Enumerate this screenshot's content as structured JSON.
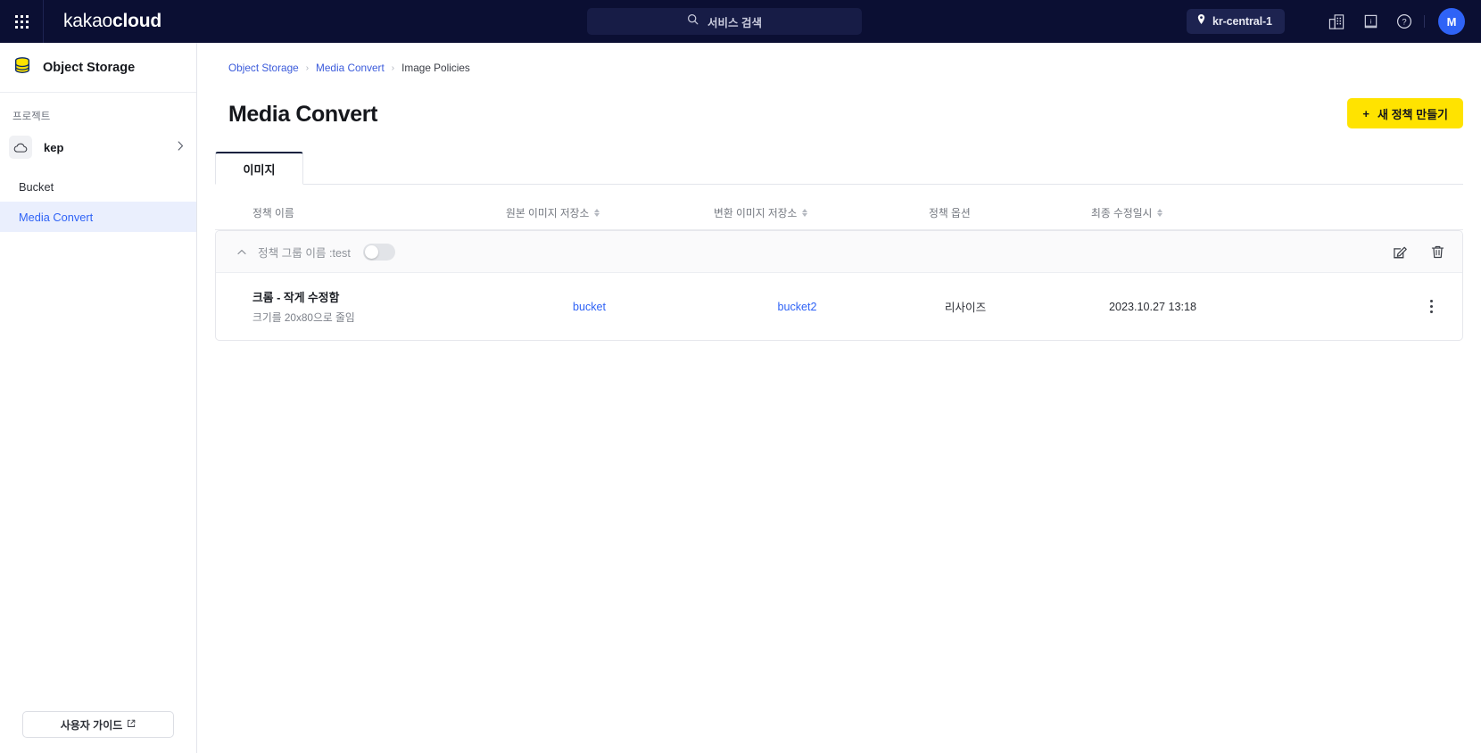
{
  "header": {
    "apps_icon": "grid-apps-icon",
    "brand_light": "kakao",
    "brand_bold": "cloud",
    "search": {
      "icon": "search-icon",
      "label": "서비스 검색",
      "placeholder": "서비스 검색"
    },
    "region": {
      "icon": "location-pin-icon",
      "label": "kr-central-1"
    },
    "icons": [
      {
        "name": "console-icon",
        "label": "콘솔"
      },
      {
        "name": "docs-icon",
        "label": "문서"
      },
      {
        "name": "help-icon",
        "label": "도움말"
      }
    ],
    "avatar": {
      "initial": "M"
    }
  },
  "sidebar": {
    "service": {
      "icon": "object-storage-icon",
      "title": "Object Storage"
    },
    "project_label": "프로젝트",
    "project": {
      "icon": "cloud-icon",
      "name": "kep",
      "chevron": "chevron-right-icon"
    },
    "nav": [
      {
        "label": "Bucket",
        "active": false
      },
      {
        "label": "Media Convert",
        "active": true
      }
    ],
    "guide": {
      "label": "사용자 가이드",
      "icon": "external-link-icon"
    }
  },
  "main": {
    "breadcrumb": {
      "items": [
        "Object Storage",
        "Media Convert"
      ],
      "current": "Image Policies",
      "separator": "›"
    },
    "title": "Media Convert",
    "create_button": {
      "plus": "+",
      "label": "새 정책 만들기",
      "color": "#ffe300"
    },
    "tabs": [
      {
        "label": "이미지",
        "active": true
      }
    ],
    "table": {
      "columns": [
        {
          "label": "정책 이름",
          "sortable": false
        },
        {
          "label": "원본 이미지 저장소",
          "sortable": true
        },
        {
          "label": "변환 이미지 저장소",
          "sortable": true
        },
        {
          "label": "정책 옵션",
          "sortable": false
        },
        {
          "label": "최종 수정일시",
          "sortable": true
        }
      ],
      "group": {
        "caret": "chevron-up-icon",
        "label": "정책 그룹 이름 :test",
        "toggle_on": false,
        "actions": [
          {
            "name": "edit-icon",
            "label": "수정"
          },
          {
            "name": "trash-icon",
            "label": "삭제"
          }
        ]
      },
      "rows": [
        {
          "name": "크롬 - 작게 수정함",
          "description": "크기를 20x80으로 줄임",
          "source_bucket": "bucket",
          "target_bucket": "bucket2",
          "option": "리사이즈",
          "updated_at": "2023.10.27 13:18",
          "menu": "kebab-menu-icon"
        }
      ]
    }
  }
}
